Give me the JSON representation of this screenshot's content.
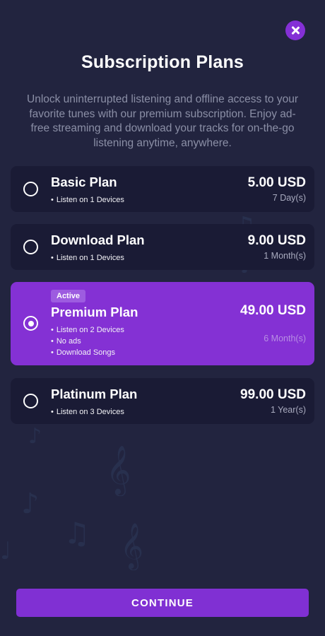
{
  "header": {
    "title": "Subscription Plans",
    "description": "Unlock uninterrupted listening and offline access to your favorite tunes with our premium subscription. Enjoy ad-free streaming and download your tracks for on-the-go listening anytime, anywhere.",
    "close_icon": "close-icon"
  },
  "plans": [
    {
      "name": "Basic Plan",
      "price": "5.00 USD",
      "period": "7 Day(s)",
      "features": [
        "Listen on 1 Devices"
      ],
      "selected": false
    },
    {
      "name": "Download Plan",
      "price": "9.00 USD",
      "period": "1 Month(s)",
      "features": [
        "Listen on 1 Devices"
      ],
      "selected": false
    },
    {
      "name": "Premium Plan",
      "price": "49.00 USD",
      "period": "6 Month(s)",
      "badge": "Active",
      "features": [
        "Listen on 2 Devices",
        "No ads",
        "Download Songs"
      ],
      "selected": true
    },
    {
      "name": "Platinum Plan",
      "price": "99.00 USD",
      "period": "1 Year(s)",
      "features": [
        "Listen on 3 Devices"
      ],
      "selected": false
    }
  ],
  "footer": {
    "continue_label": "CONTINUE"
  },
  "colors": {
    "background": "#22243f",
    "card": "#1a1b35",
    "accent": "#8431d4"
  }
}
